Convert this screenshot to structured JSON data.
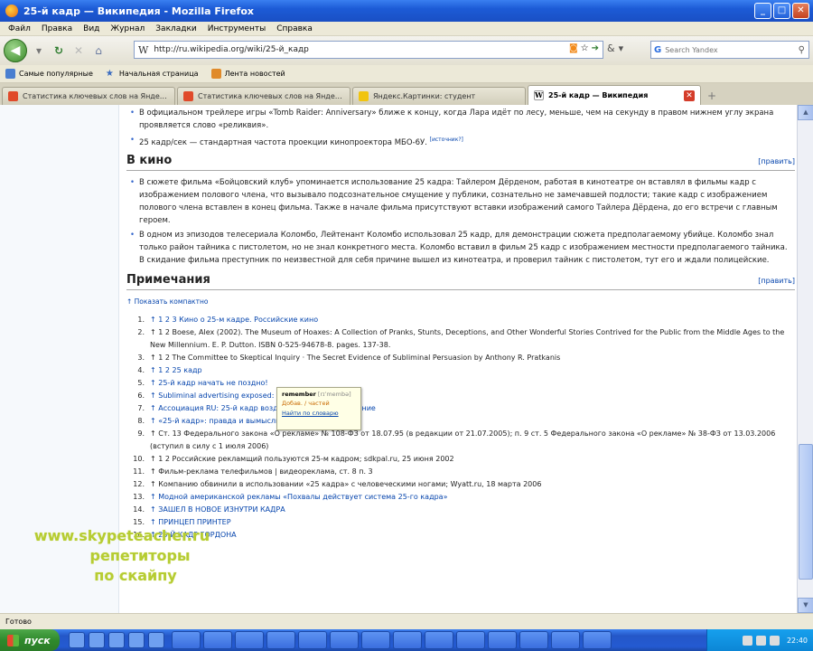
{
  "window": {
    "title": "25-й кадр — Википедия - Mozilla Firefox",
    "buttons": {
      "minimize": "_",
      "maximize": "□",
      "close": "✕"
    }
  },
  "menu": [
    "Файл",
    "Правка",
    "Вид",
    "Журнал",
    "Закладки",
    "Инструменты",
    "Справка"
  ],
  "nav": {
    "url": "http://ru.wikipedia.org/wiki/25-й_кадр",
    "wlogo": "W",
    "search_placeholder": "Search Yandex",
    "search_logo": "G"
  },
  "bookmarks": [
    {
      "label": "Самые популярные",
      "icon": "feed"
    },
    {
      "label": "Начальная страница",
      "icon": "star"
    },
    {
      "label": "Лента новостей",
      "icon": "news"
    }
  ],
  "tabs": [
    {
      "label": "Статистика ключевых слов на Янде…",
      "favicon_color": "#e04a2a",
      "active": false
    },
    {
      "label": "Статистика ключевых слов на Янде…",
      "favicon_color": "#e04a2a",
      "active": false
    },
    {
      "label": "Яндекс.Картинки: студент",
      "favicon_color": "#f1c40f",
      "active": false
    },
    {
      "label": "25-й кадр — Википедия",
      "favicon_color": "#ffffff",
      "active": true
    }
  ],
  "article": {
    "intro_items": [
      "В официальном трейлере игры «Tomb Raider: Anniversary» ближе к концу, когда Лара идёт по лесу, меньше, чем на секунду в правом нижнем углу экрана проявляется слово «реликвия».",
      "25 кадр/сек — стандартная частота проекции кинопроектора МБО-6У."
    ],
    "intro_sup": "[источник?]",
    "section_cinema": "В кино",
    "edit_label": "[править]",
    "cinema_items": [
      "В сюжете фильма «Бойцовский клуб» упоминается использование 25 кадра: Тайлером Дёрденом, работая в кинотеатре он вставлял в фильмы кадр с изображением полового члена, что вызывало подсознательное смущение у публики, сознательно не замечавшей подлости; такие кадр с изображением полового члена вставлен в конец фильма. Также в начале фильма присутствуют вставки изображений самого Тайлера Дёрдена, до его встречи с главным героем.",
      "В одном из эпизодов телесериала Коломбо, Лейтенант Коломбо использовал 25 кадр, для демонстрации сюжета предполагаемому убийце. Коломбо знал только район тайника с пистолетом, но не знал конкретного места. Коломбо вставил в фильм 25 кадр с изображением местности предполагаемого тайника. В скидание фильма преступник по неизвестной для себя причине вышел из кинотеатра, и проверил тайник с пистолетом, тут его и ждали полицейские."
    ],
    "section_notes": "Примечания",
    "show_compact": "↑ Показать компактно",
    "notes": [
      {
        "n": "1.",
        "text": "↑ 1 2 3 Кино о 25-м кадре. Российские кино"
      },
      {
        "n": "2.",
        "text": "↑ 1 2 Boese, Alex (2002). The Museum of Hoaxes: A Collection of Pranks, Stunts, Deceptions, and Other Wonderful Stories Contrived for the Public from the Middle Ages to the New Millennium. E. P. Dutton. ISBN 0-525-94678-8. pages. 137-38."
      },
      {
        "n": "3.",
        "text": "↑ 1 2 The Committee to Skeptical Inquiry · The Secret Evidence of Subliminal Persuasion by Anthony R. Pratkanis"
      },
      {
        "n": "4.",
        "text": "↑ 1 2 25 кадр"
      },
      {
        "n": "5.",
        "text": "↑ 25-й кадр начать не поздно!"
      },
      {
        "n": "6.",
        "text": "↑ Subliminal advertising exposed: what all… Seen"
      },
      {
        "n": "7.",
        "text": "↑ Ассоциация RU: 25-й кадр воздействует на подсознание"
      },
      {
        "n": "8.",
        "text": "↑ «25-й кадр»: правда и вымыслы"
      },
      {
        "n": "9.",
        "text": "↑ Ст. 13 Федерального закона «О рекламе» № 108-ФЗ от 18.07.95 (в редакции от 21.07.2005); п. 9 ст. 5 Федерального закона «О рекламе» № 38-ФЗ от 13.03.2006 (вступил в силу с 1 июля 2006)"
      },
      {
        "n": "10.",
        "text": "↑ 1 2 Российские рекламщий пользуются 25-м кадром; sdkpal.ru, 25 июня 2002"
      },
      {
        "n": "11.",
        "text": "↑ Фильм-реклама телефильмов | видеореклама, ст. 8 п. 3"
      },
      {
        "n": "12.",
        "text": "↑ Компанию обвинили в использовании «25 кадра» с человеческими ногами; Wyatt.ru, 18 марта 2006"
      },
      {
        "n": "13.",
        "text": "↑ Модной американской рекламы «Похвалы действует система 25-го кадра»"
      },
      {
        "n": "14.",
        "text": "↑ ЗАШЕЛ В НОВОЕ ИЗНУТРИ КАДРА"
      },
      {
        "n": "15.",
        "text": "↑ ПРИНЦЕП ПРИНТЕР"
      },
      {
        "n": "16.",
        "text": "↑ 25-Й КАДР ГОРДОНА"
      }
    ]
  },
  "popup": {
    "word": "remember",
    "transcription": "[rɪˈmembə]",
    "translation": "Добав. / частей",
    "link": "Найти по словарю"
  },
  "watermark": {
    "line1": "www.skypeteacher.ru",
    "line2": "репетиторы",
    "line3": "по скайпу"
  },
  "status": "Готово",
  "taskbar": {
    "start_label": "пуск",
    "clock": "22:40"
  },
  "colors": {
    "titlebar": "#1c5bd6",
    "link": "#0645ad",
    "watermark": "#b6cc32",
    "taskbar": "#245ad2",
    "start": "#2f8a2c"
  }
}
